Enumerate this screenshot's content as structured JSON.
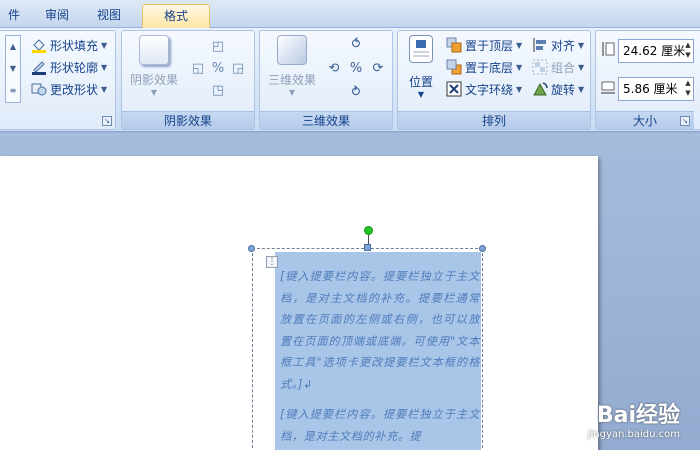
{
  "tabs": [
    {
      "label": "件"
    },
    {
      "label": "审阅"
    },
    {
      "label": "视图"
    },
    {
      "label": "格式",
      "active": true
    }
  ],
  "groups": {
    "shape_styles": {
      "fill": "形状填充",
      "outline": "形状轮廓",
      "change_shape": "更改形状"
    },
    "shadow_effects": {
      "button": "阴影效果",
      "label": "阴影效果"
    },
    "threed_effects": {
      "button": "三维效果",
      "label": "三维效果"
    },
    "arrange": {
      "label": "排列",
      "position": "位置",
      "bring_front": "置于顶层",
      "send_back": "置于底层",
      "text_wrap": "文字环绕",
      "align": "对齐",
      "group": "组合",
      "rotate": "旋转"
    },
    "size": {
      "label": "大小",
      "height": "24.62 厘米",
      "width": "5.86 厘米"
    }
  },
  "document": {
    "paragraph1": "[键入提要栏内容。提要栏独立于主文档，是对主文档的补充。提要栏通常放置在页面的左侧或右侧，也可以放置在页面的顶端或底端。可使用\"文本框工具\"选项卡更改提要栏文本框的格式。]↲",
    "paragraph2": "[键入提要栏内容。提要栏独立于主文档，是对主文档的补充。提"
  },
  "watermark": {
    "main": "Bai经验",
    "sub": "jingyan.baidu.com"
  },
  "colors": {
    "accent_tab": "#ffe7a6",
    "selection": "#a9c5e8",
    "ribbon": "#d8e5f6"
  }
}
